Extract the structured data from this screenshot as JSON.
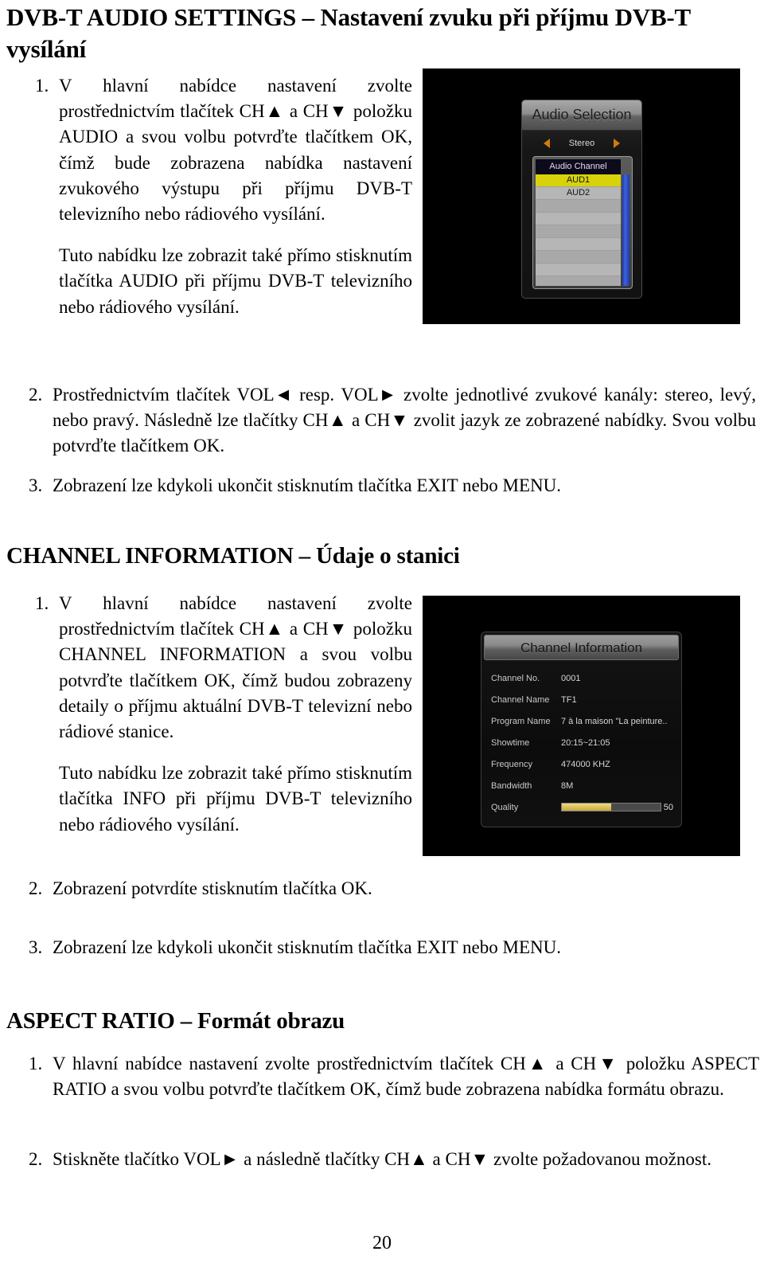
{
  "document": {
    "page_number": "20"
  },
  "sections": {
    "audio": {
      "heading": "DVB-T AUDIO SETTINGS – Nastavení zvuku při příjmu DVB-T vysílání",
      "items": [
        {
          "num": "1.",
          "para1": "V hlavní nabídce nastavení zvolte prostřednictvím tlačítek CH▲ a CH▼ položku AUDIO a svou volbu potvrďte tlačítkem OK, čímž bude zobrazena nabídka nastavení zvukového výstupu při příjmu DVB-T televizního nebo rádiového vysílání.",
          "para2": "Tuto nabídku lze zobrazit také přímo stisknutím tlačítka AUDIO při příjmu DVB-T televizního nebo rádiového vysílání."
        },
        {
          "num": "2.",
          "para1": "Prostřednictvím tlačítek VOL◄ resp. VOL► zvolte jednotlivé zvukové kanály: stereo, levý, nebo pravý. Následně lze tlačítky CH▲ a CH▼ zvolit jazyk ze zobrazené nabídky. Svou volbu potvrďte tlačítkem OK."
        },
        {
          "num": "3.",
          "para1": "Zobrazení lze kdykoli ukončit stisknutím tlačítka EXIT nebo MENU."
        }
      ]
    },
    "channel": {
      "heading": "CHANNEL INFORMATION – Údaje o stanici",
      "items": [
        {
          "num": "1.",
          "para1": "V hlavní nabídce nastavení zvolte prostřednictvím tlačítek CH▲ a CH▼ položku CHANNEL INFORMATION a svou volbu potvrďte tlačítkem OK, čímž budou zobrazeny detaily o příjmu aktuální DVB-T televizní nebo rádiové stanice.",
          "para2": "Tuto nabídku lze zobrazit také přímo stisknutím tlačítka INFO při příjmu DVB-T televizního nebo rádiového vysílání."
        },
        {
          "num": "2.",
          "para1": "Zobrazení potvrdíte stisknutím tlačítka OK."
        },
        {
          "num": "3.",
          "para1": "Zobrazení lze kdykoli ukončit stisknutím tlačítka EXIT nebo MENU."
        }
      ]
    },
    "aspect": {
      "heading": "ASPECT RATIO – Formát obrazu",
      "items": [
        {
          "num": "1.",
          "para1": "V hlavní nabídce nastavení zvolte prostřednictvím tlačítek CH▲ a CH▼ položku ASPECT RATIO a svou volbu potvrďte tlačítkem OK, čímž bude zobrazena nabídka formátu obrazu."
        },
        {
          "num": "2.",
          "para1": "Stiskněte tlačítko VOL► a následně tlačítky CH▲ a CH▼ zvolte požadovanou možnost."
        }
      ]
    }
  },
  "screenshots": {
    "audio_selection": {
      "title": "Audio Selection",
      "mode_value": "Stereo",
      "list_header": "Audio Channel",
      "list_items": [
        "AUD1",
        "AUD2"
      ],
      "selected_item": "AUD1",
      "colors": {
        "selected_bg": "#d8d20a",
        "row_bg": "#b6b6b6",
        "header_bg": "#0b0b1c",
        "scrollbar": "#3f63d8",
        "arrow": "#d07a10"
      }
    },
    "channel_information": {
      "title": "Channel Information",
      "rows": [
        {
          "label": "Channel No.",
          "value": "0001"
        },
        {
          "label": "Channel Name",
          "value": "TF1"
        },
        {
          "label": "Program Name",
          "value": "7 à la maison \"La peinture.."
        },
        {
          "label": "Showtime",
          "value": "20:15~21:05"
        },
        {
          "label": "Frequency",
          "value": "474000 KHZ"
        },
        {
          "label": "Bandwidth",
          "value": "8M"
        }
      ],
      "quality": {
        "label": "Quality",
        "value": "50",
        "percent": 50
      },
      "colors": {
        "quality_fill": "#d9be55",
        "quality_track": "#4a4a4a"
      }
    }
  }
}
